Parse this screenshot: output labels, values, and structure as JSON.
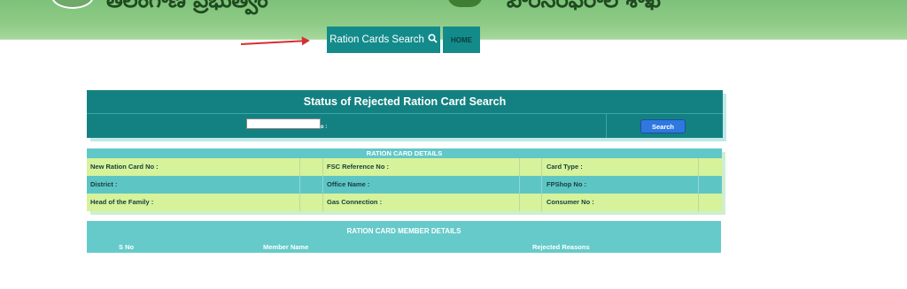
{
  "colors": {
    "banner_green": "#8fcb86",
    "teal": "#138181",
    "light_teal": "#5ec5c5",
    "light_green": "#d6f29a",
    "search_blue": "#2f78e0",
    "arrow_red": "#d43030"
  },
  "nav": {
    "ration_cards_search": "Ration Cards Search",
    "home": "HOME",
    "search_icon": "search-icon"
  },
  "status": {
    "title": "Status of Rejected Ration Card Search",
    "rc_label": "RationCard No :",
    "rc_value": "",
    "search_button": "Search"
  },
  "details": {
    "heading": "RATION CARD DETAILS",
    "rows": [
      {
        "c1": "New Ration Card No :",
        "c2": "FSC Reference No :",
        "c3": "Card Type :"
      },
      {
        "c1": "District :",
        "c2": "Office Name :",
        "c3": "FPShop No :"
      },
      {
        "c1": "Head of the Family :",
        "c2": "Gas Connection :",
        "c3": "Consumer No :"
      }
    ]
  },
  "member": {
    "heading": "RATION CARD MEMBER DETAILS",
    "columns": [
      "S No",
      "Member Name",
      "Rejected Reasons"
    ]
  }
}
